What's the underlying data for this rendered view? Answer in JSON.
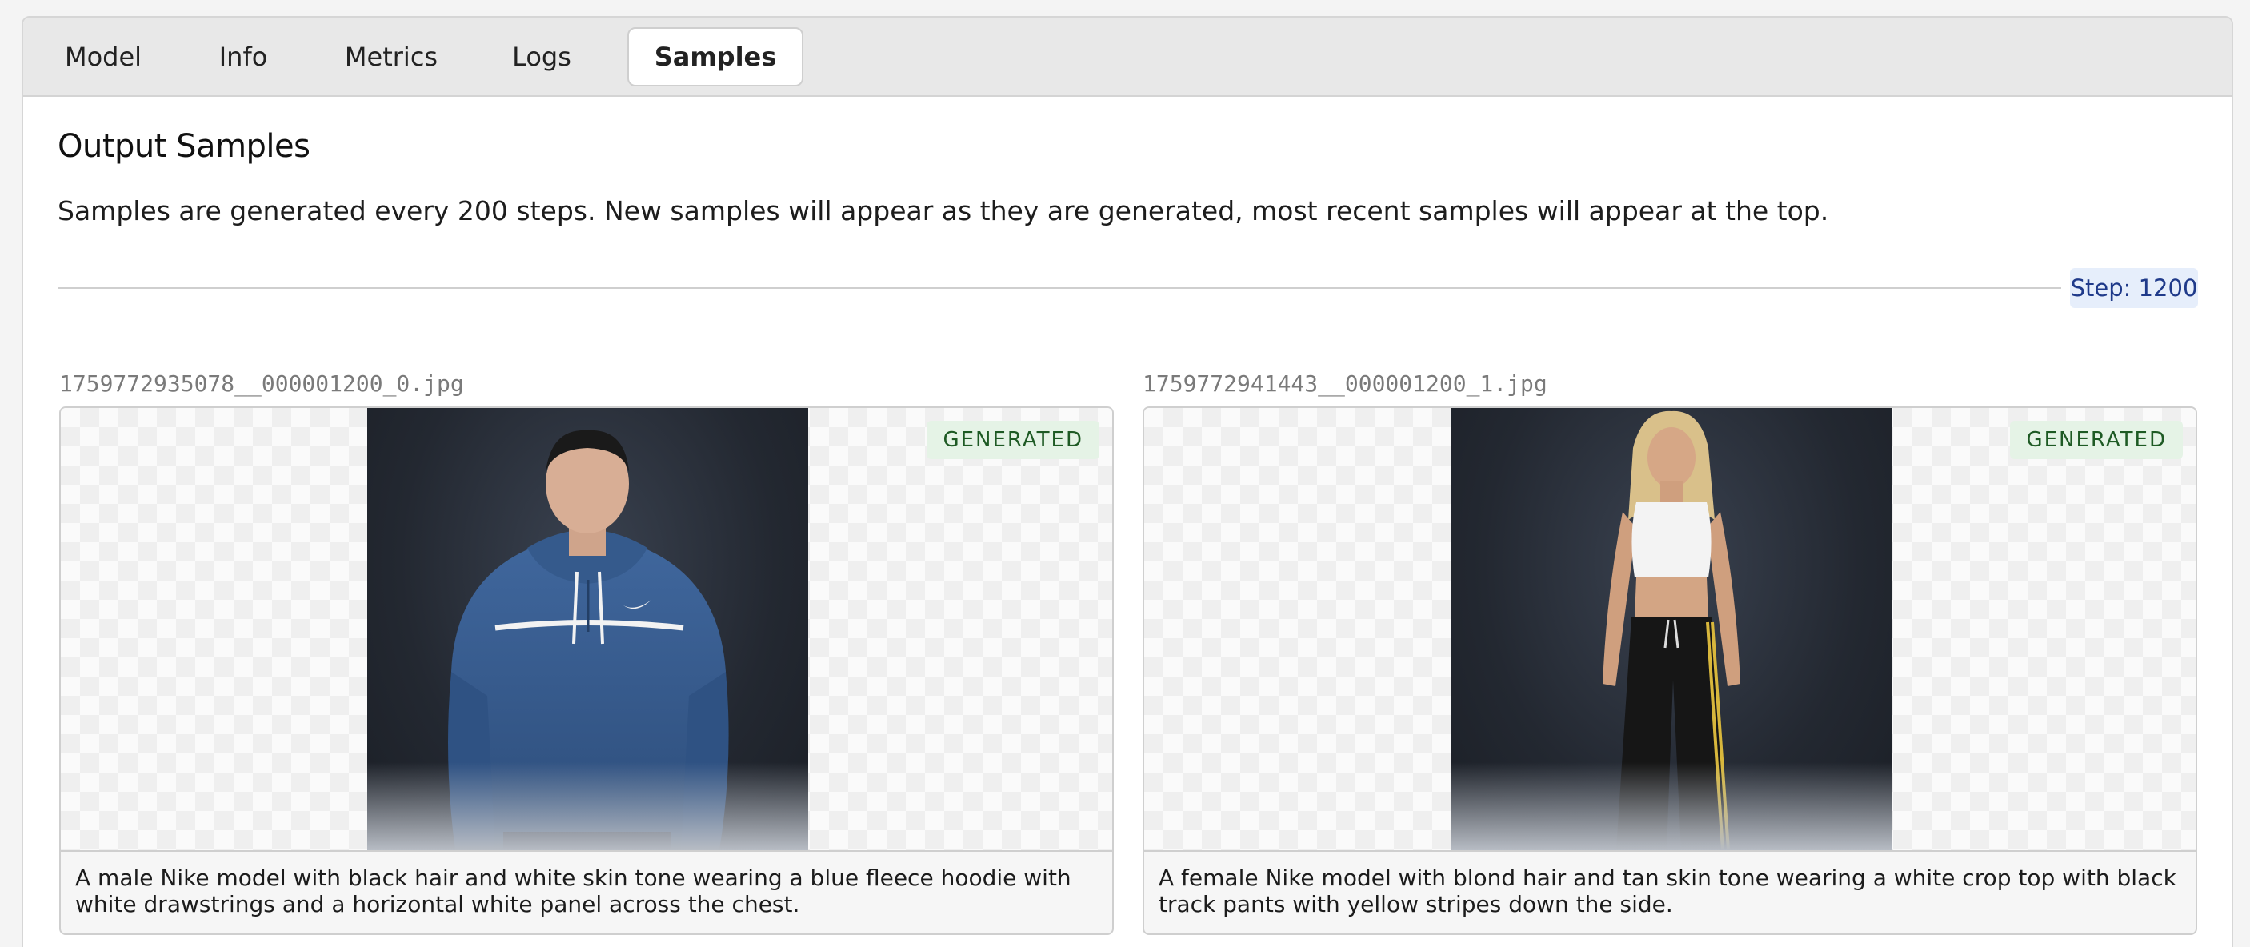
{
  "tabs": [
    {
      "label": "Model"
    },
    {
      "label": "Info"
    },
    {
      "label": "Metrics"
    },
    {
      "label": "Logs"
    },
    {
      "label": "Samples"
    }
  ],
  "active_tab": "Samples",
  "section": {
    "title": "Output Samples",
    "description": "Samples are generated every 200 steps. New samples will appear as they are generated, most recent samples will appear at the top.",
    "step_label": "Step: 1200"
  },
  "samples": [
    {
      "filename": "1759772935078__000001200_0.jpg",
      "badge": "GENERATED",
      "caption": "A male Nike model with black hair and white skin tone wearing a blue fleece hoodie with white drawstrings and a horizontal white panel across the chest."
    },
    {
      "filename": "1759772941443__000001200_1.jpg",
      "badge": "GENERATED",
      "caption": "A female Nike model with blond hair and tan skin tone wearing a white crop top with black track pants with yellow stripes down the side."
    }
  ],
  "colors": {
    "badge_bg": "#e5f3e6",
    "badge_text": "#1e5a24",
    "step_bg": "#e6eefb",
    "step_text": "#1f3a8a",
    "hoodie": "#3a5f93"
  }
}
